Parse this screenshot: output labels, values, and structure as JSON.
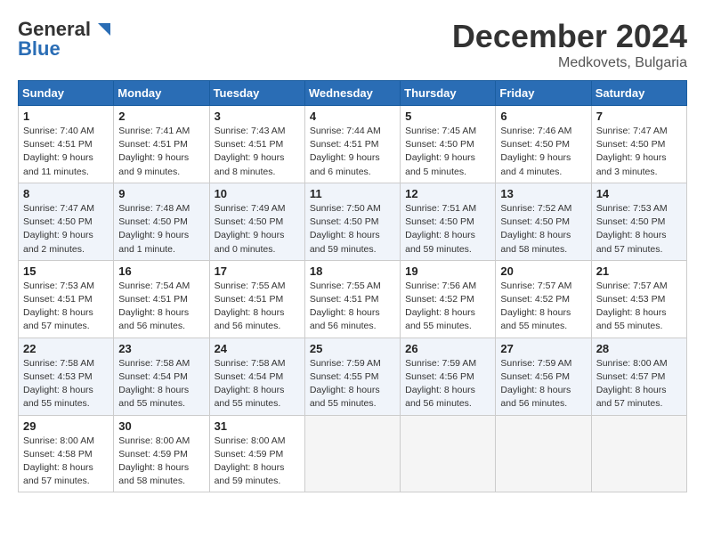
{
  "header": {
    "logo_line1": "General",
    "logo_line2": "Blue",
    "month": "December 2024",
    "location": "Medkovets, Bulgaria"
  },
  "weekdays": [
    "Sunday",
    "Monday",
    "Tuesday",
    "Wednesday",
    "Thursday",
    "Friday",
    "Saturday"
  ],
  "weeks": [
    [
      {
        "day": 1,
        "sunrise": "7:40 AM",
        "sunset": "4:51 PM",
        "daylight": "9 hours and 11 minutes."
      },
      {
        "day": 2,
        "sunrise": "7:41 AM",
        "sunset": "4:51 PM",
        "daylight": "9 hours and 9 minutes."
      },
      {
        "day": 3,
        "sunrise": "7:43 AM",
        "sunset": "4:51 PM",
        "daylight": "9 hours and 8 minutes."
      },
      {
        "day": 4,
        "sunrise": "7:44 AM",
        "sunset": "4:51 PM",
        "daylight": "9 hours and 6 minutes."
      },
      {
        "day": 5,
        "sunrise": "7:45 AM",
        "sunset": "4:50 PM",
        "daylight": "9 hours and 5 minutes."
      },
      {
        "day": 6,
        "sunrise": "7:46 AM",
        "sunset": "4:50 PM",
        "daylight": "9 hours and 4 minutes."
      },
      {
        "day": 7,
        "sunrise": "7:47 AM",
        "sunset": "4:50 PM",
        "daylight": "9 hours and 3 minutes."
      }
    ],
    [
      {
        "day": 8,
        "sunrise": "7:47 AM",
        "sunset": "4:50 PM",
        "daylight": "9 hours and 2 minutes."
      },
      {
        "day": 9,
        "sunrise": "7:48 AM",
        "sunset": "4:50 PM",
        "daylight": "9 hours and 1 minute."
      },
      {
        "day": 10,
        "sunrise": "7:49 AM",
        "sunset": "4:50 PM",
        "daylight": "9 hours and 0 minutes."
      },
      {
        "day": 11,
        "sunrise": "7:50 AM",
        "sunset": "4:50 PM",
        "daylight": "8 hours and 59 minutes."
      },
      {
        "day": 12,
        "sunrise": "7:51 AM",
        "sunset": "4:50 PM",
        "daylight": "8 hours and 59 minutes."
      },
      {
        "day": 13,
        "sunrise": "7:52 AM",
        "sunset": "4:50 PM",
        "daylight": "8 hours and 58 minutes."
      },
      {
        "day": 14,
        "sunrise": "7:53 AM",
        "sunset": "4:50 PM",
        "daylight": "8 hours and 57 minutes."
      }
    ],
    [
      {
        "day": 15,
        "sunrise": "7:53 AM",
        "sunset": "4:51 PM",
        "daylight": "8 hours and 57 minutes."
      },
      {
        "day": 16,
        "sunrise": "7:54 AM",
        "sunset": "4:51 PM",
        "daylight": "8 hours and 56 minutes."
      },
      {
        "day": 17,
        "sunrise": "7:55 AM",
        "sunset": "4:51 PM",
        "daylight": "8 hours and 56 minutes."
      },
      {
        "day": 18,
        "sunrise": "7:55 AM",
        "sunset": "4:51 PM",
        "daylight": "8 hours and 56 minutes."
      },
      {
        "day": 19,
        "sunrise": "7:56 AM",
        "sunset": "4:52 PM",
        "daylight": "8 hours and 55 minutes."
      },
      {
        "day": 20,
        "sunrise": "7:57 AM",
        "sunset": "4:52 PM",
        "daylight": "8 hours and 55 minutes."
      },
      {
        "day": 21,
        "sunrise": "7:57 AM",
        "sunset": "4:53 PM",
        "daylight": "8 hours and 55 minutes."
      }
    ],
    [
      {
        "day": 22,
        "sunrise": "7:58 AM",
        "sunset": "4:53 PM",
        "daylight": "8 hours and 55 minutes."
      },
      {
        "day": 23,
        "sunrise": "7:58 AM",
        "sunset": "4:54 PM",
        "daylight": "8 hours and 55 minutes."
      },
      {
        "day": 24,
        "sunrise": "7:58 AM",
        "sunset": "4:54 PM",
        "daylight": "8 hours and 55 minutes."
      },
      {
        "day": 25,
        "sunrise": "7:59 AM",
        "sunset": "4:55 PM",
        "daylight": "8 hours and 55 minutes."
      },
      {
        "day": 26,
        "sunrise": "7:59 AM",
        "sunset": "4:56 PM",
        "daylight": "8 hours and 56 minutes."
      },
      {
        "day": 27,
        "sunrise": "7:59 AM",
        "sunset": "4:56 PM",
        "daylight": "8 hours and 56 minutes."
      },
      {
        "day": 28,
        "sunrise": "8:00 AM",
        "sunset": "4:57 PM",
        "daylight": "8 hours and 57 minutes."
      }
    ],
    [
      {
        "day": 29,
        "sunrise": "8:00 AM",
        "sunset": "4:58 PM",
        "daylight": "8 hours and 57 minutes."
      },
      {
        "day": 30,
        "sunrise": "8:00 AM",
        "sunset": "4:59 PM",
        "daylight": "8 hours and 58 minutes."
      },
      {
        "day": 31,
        "sunrise": "8:00 AM",
        "sunset": "4:59 PM",
        "daylight": "8 hours and 59 minutes."
      },
      null,
      null,
      null,
      null
    ]
  ]
}
